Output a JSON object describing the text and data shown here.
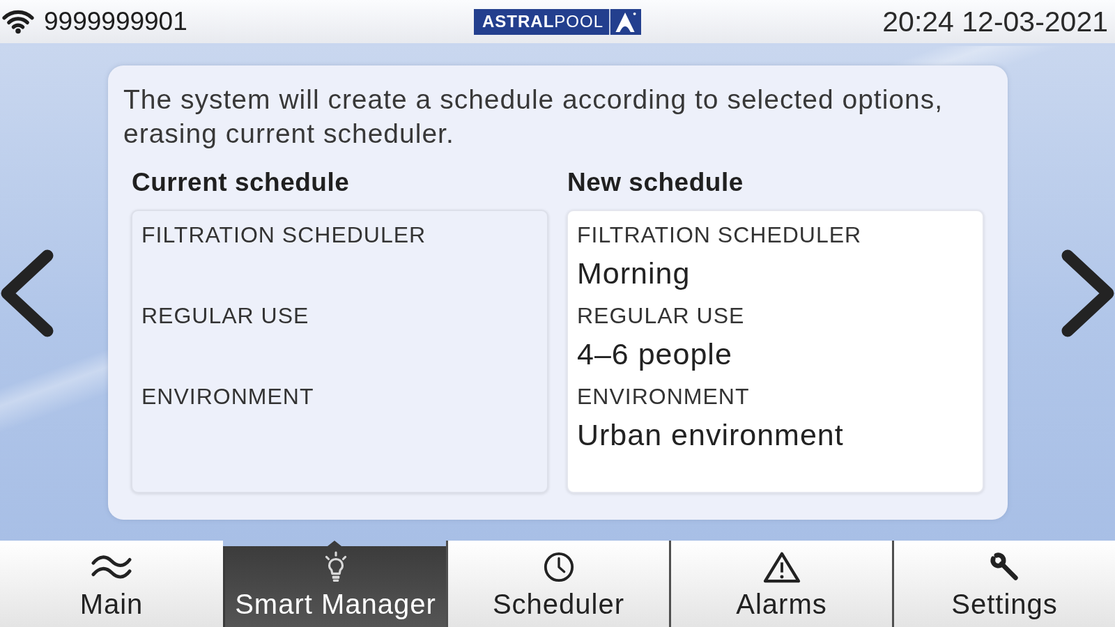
{
  "status_bar": {
    "device_id": "9999999901",
    "logo": "**ASTRAL**POOL",
    "datetime": "20:24 12-03-2021"
  },
  "dialog": {
    "message": "The system will create a schedule according to selected options, erasing current scheduler.",
    "columns": [
      {
        "kind": "current",
        "heading": "Current schedule",
        "fields": [
          {
            "label": "FILTRATION SCHEDULER"
          },
          {
            "label": "REGULAR USE"
          },
          {
            "label": "ENVIRONMENT"
          }
        ]
      },
      {
        "kind": "new",
        "heading": "New schedule",
        "fields": [
          {
            "label": "FILTRATION SCHEDULER",
            "value": "Morning"
          },
          {
            "label": "REGULAR USE",
            "value": "4–6 people"
          },
          {
            "label": "ENVIRONMENT",
            "value": "Urban environment"
          }
        ]
      }
    ]
  },
  "tab_bar": {
    "tabs": [
      {
        "label": "Main",
        "selected": false
      },
      {
        "label": "Smart Manager",
        "selected": true
      },
      {
        "label": "Scheduler",
        "selected": false
      },
      {
        "label": "Alarms",
        "selected": false
      },
      {
        "label": "Settings",
        "selected": false
      }
    ]
  }
}
